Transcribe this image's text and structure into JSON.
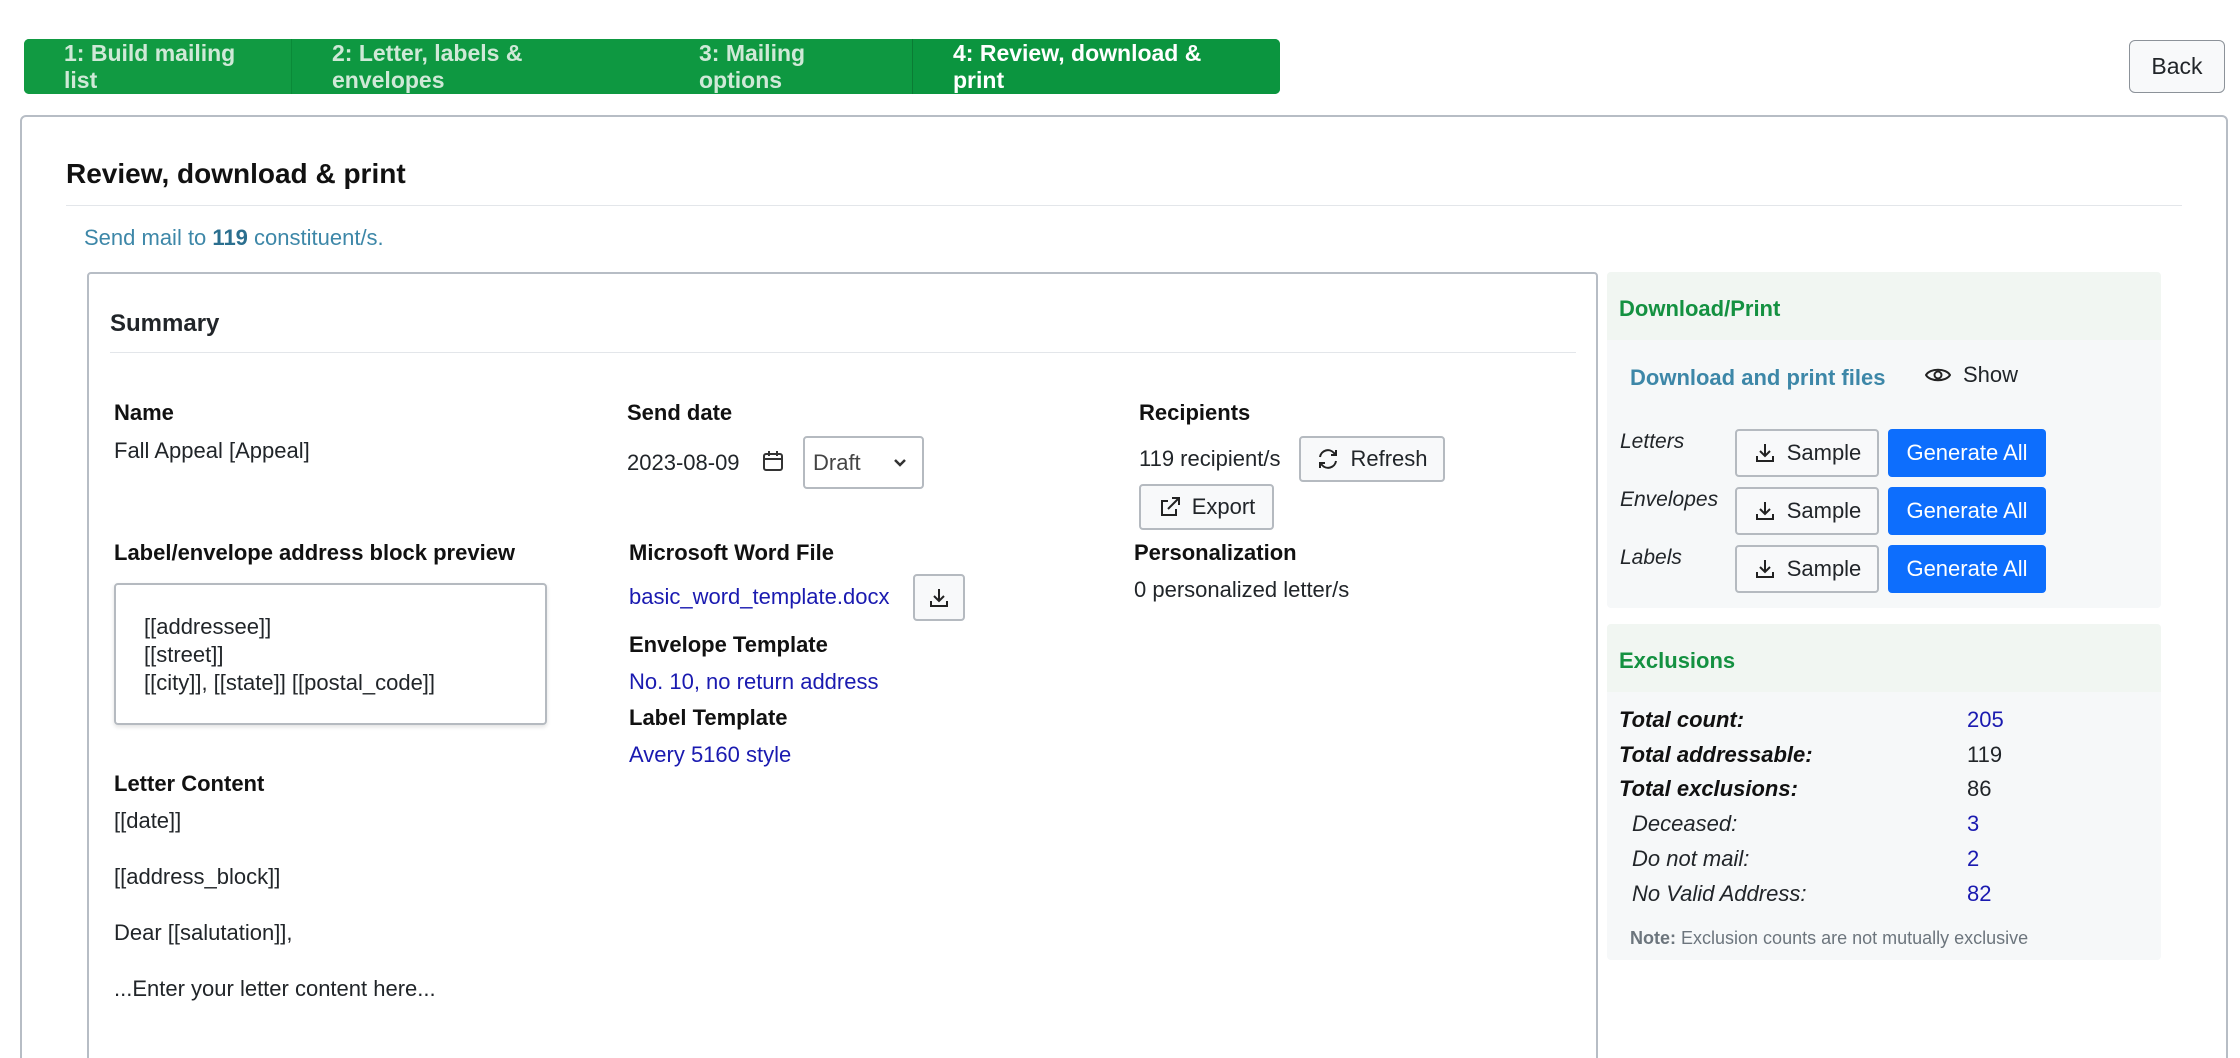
{
  "stepper": {
    "steps": [
      {
        "label": "1: Build mailing list"
      },
      {
        "label": "2: Letter, labels & envelopes"
      },
      {
        "label": "3: Mailing options"
      },
      {
        "label": "4: Review, download & print"
      }
    ]
  },
  "back_label": "Back",
  "page_title": "Review, download & print",
  "send": {
    "prefix": "Send mail to",
    "count": "119",
    "suffix": "constituent/s."
  },
  "summary": {
    "title": "Summary",
    "name_label": "Name",
    "name_value": "Fall Appeal [Appeal]",
    "send_date_label": "Send date",
    "send_date_value": "2023-08-09",
    "status_value": "Draft",
    "recipients_label": "Recipients",
    "recipients_value": "119 recipient/s",
    "refresh_label": "Refresh",
    "export_label": "Export",
    "address_preview_label": "Label/envelope address block preview",
    "address_lines": [
      "[[addressee]]",
      "[[street]]",
      "[[city]], [[state]] [[postal_code]]"
    ],
    "word_label": "Microsoft Word File",
    "word_file": "basic_word_template.docx",
    "envelope_label": "Envelope Template",
    "envelope_value": "No. 10, no return address",
    "label_template_label": "Label Template",
    "label_template_value": "Avery 5160 style",
    "personalization_label": "Personalization",
    "personalization_value": "0 personalized letter/s",
    "letter_content_label": "Letter Content",
    "letter_lines": [
      "[[date]]",
      "[[address_block]]",
      "Dear [[salutation]],",
      "...Enter your letter content here..."
    ]
  },
  "download": {
    "title": "Download/Print",
    "files_label": "Download and print files",
    "show_label": "Show",
    "rows": [
      {
        "label": "Letters",
        "sample": "Sample",
        "generate": "Generate All"
      },
      {
        "label": "Envelopes",
        "sample": "Sample",
        "generate": "Generate All"
      },
      {
        "label": "Labels",
        "sample": "Sample",
        "generate": "Generate All"
      }
    ]
  },
  "exclusions": {
    "title": "Exclusions",
    "rows": [
      {
        "label": "Total count:",
        "value": "205"
      },
      {
        "label": "Total addressable:",
        "value": "119"
      },
      {
        "label": "Total exclusions:",
        "value": "86"
      },
      {
        "label": "Deceased:",
        "value": "3"
      },
      {
        "label": "Do not mail:",
        "value": "2"
      },
      {
        "label": "No Valid Address:",
        "value": "82"
      }
    ],
    "note_label": "Note:",
    "note_text": "Exclusion counts are not mutually exclusive"
  },
  "colors": {
    "primary": "#0d6efd",
    "success": "#0b9a3e",
    "link": "#1a1ab0",
    "info": "#3d87a8"
  }
}
